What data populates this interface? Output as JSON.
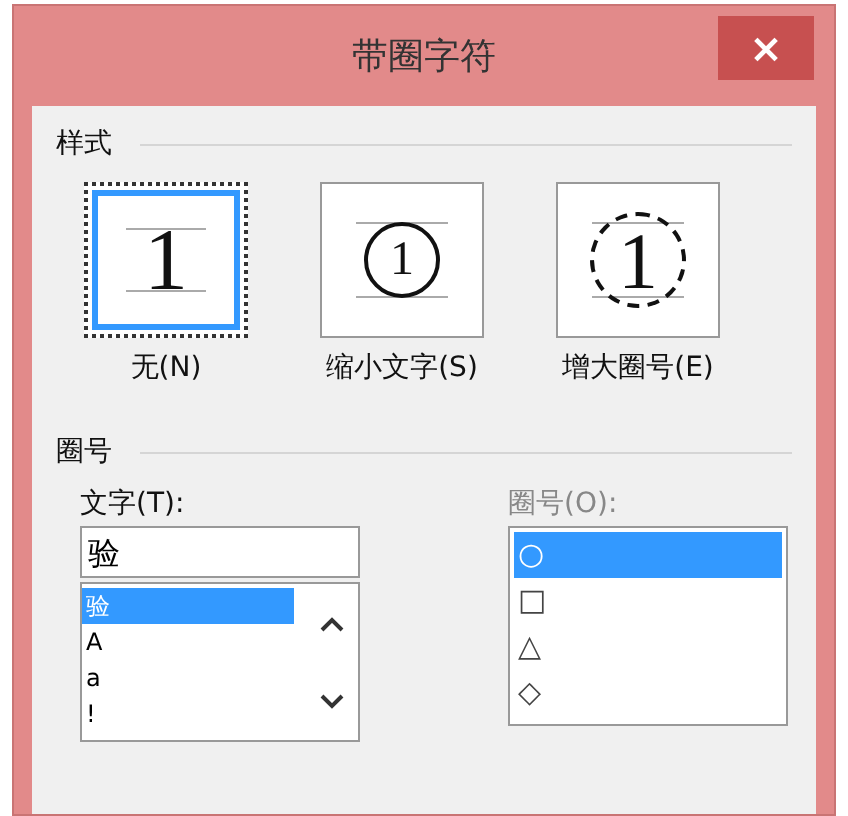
{
  "window": {
    "title": "带圈字符",
    "close": "×"
  },
  "style_section": {
    "label": "样式",
    "options": [
      {
        "kind": "plain",
        "preview": "1",
        "label": "无(N)",
        "selected": true
      },
      {
        "kind": "small_circle",
        "preview": "1",
        "label": "缩小文字(S)",
        "selected": false
      },
      {
        "kind": "large_circle",
        "preview": "1",
        "label": "增大圈号(E)",
        "selected": false
      }
    ]
  },
  "enclose_section": {
    "label": "圈号",
    "text": {
      "label": "文字(T):",
      "value": "验",
      "items": [
        {
          "text": "验",
          "selected": true
        },
        {
          "text": "A",
          "selected": false
        },
        {
          "text": "a",
          "selected": false
        },
        {
          "text": "!",
          "selected": false
        }
      ]
    },
    "enclosure": {
      "label": "圈号(O):",
      "disabled": true,
      "items": [
        {
          "text": "○",
          "selected": true
        },
        {
          "text": "□",
          "selected": false
        },
        {
          "text": "△",
          "selected": false
        },
        {
          "text": "◇",
          "selected": false
        }
      ]
    }
  }
}
